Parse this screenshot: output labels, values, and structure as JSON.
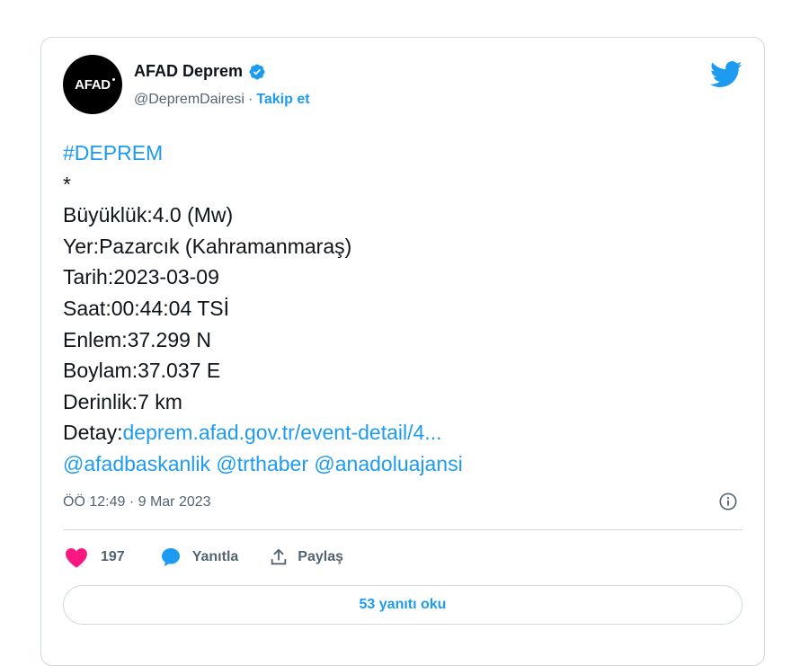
{
  "author": {
    "avatar_text": "AFAD",
    "display_name": "AFAD Deprem",
    "handle": "@DepremDairesi",
    "separator": "·",
    "follow_label": "Takip et"
  },
  "tweet": {
    "hashtag": "#DEPREM",
    "asterisk": "*",
    "lines": [
      "Büyüklük:4.0 (Mw)",
      "Yer:Pazarcık (Kahramanmaraş)",
      "Tarih:2023-03-09",
      "Saat:00:44:04 TSİ",
      "Enlem:37.299 N",
      "Boylam:37.037 E",
      "Derinlik:7 km"
    ],
    "detail_prefix": "Detay:",
    "detail_link": "deprem.afad.gov.tr/event-detail/4...",
    "mentions": [
      "@afadbaskanlik",
      "@trthaber",
      "@anadoluajansi"
    ]
  },
  "timestamp": "ÖÖ 12:49 · 9 Mar 2023",
  "actions": {
    "like_count": "197",
    "reply_label": "Yanıtla",
    "share_label": "Paylaş"
  },
  "read_replies_label": "53 yanıtı oku",
  "colors": {
    "accent": "#1d9bf0",
    "like": "#f91880",
    "text": "#0f1419",
    "muted": "#536471",
    "border": "#cfd9de"
  },
  "icons": [
    "verified-badge-icon",
    "twitter-bird-icon",
    "info-icon",
    "heart-icon",
    "reply-bubble-icon",
    "share-icon"
  ]
}
